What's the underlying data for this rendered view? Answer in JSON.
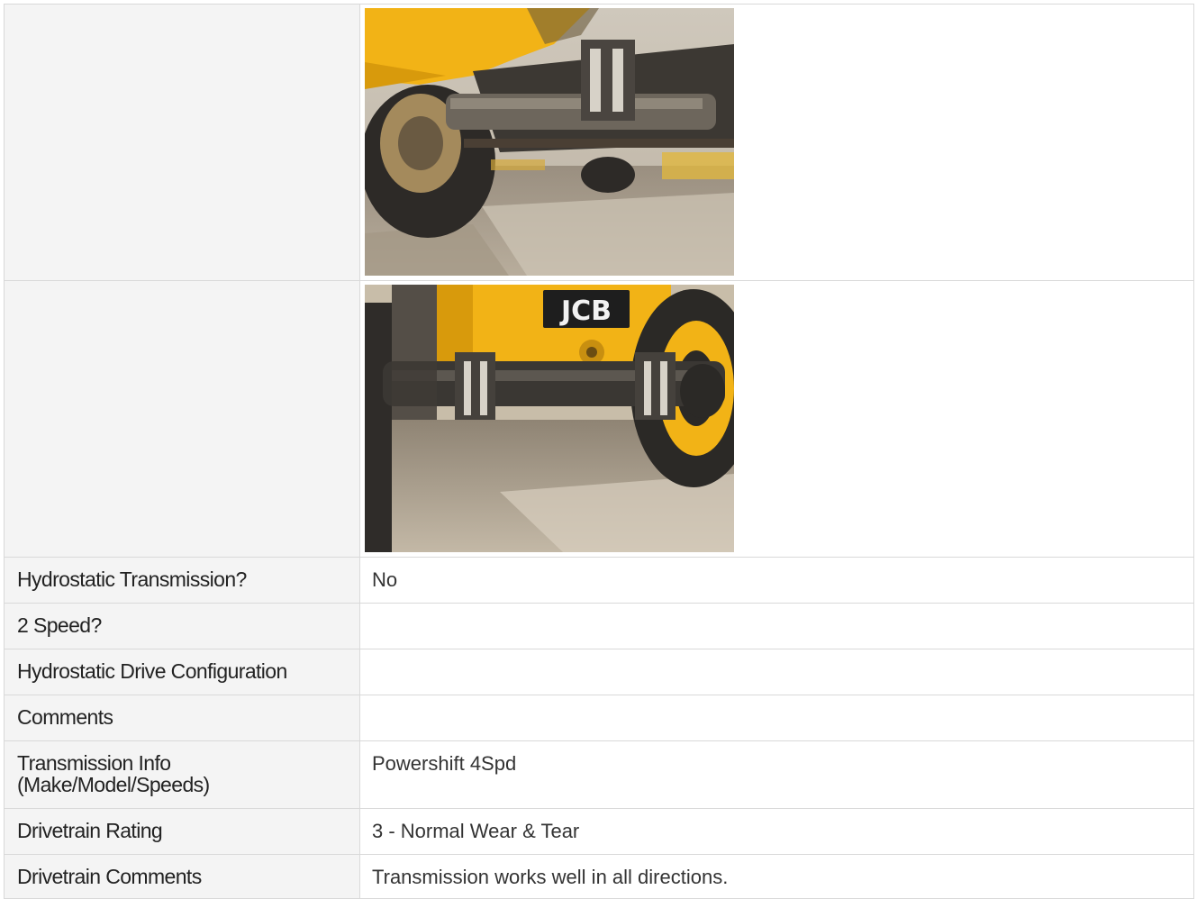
{
  "rows": [
    {
      "label": "",
      "image": "photo-axle-rear"
    },
    {
      "label": "",
      "image": "photo-axle-front-jcb"
    },
    {
      "label": "Hydrostatic Transmission?",
      "value": "No"
    },
    {
      "label": "2 Speed?",
      "value": ""
    },
    {
      "label": "Hydrostatic Drive Configuration",
      "value": ""
    },
    {
      "label": "Comments",
      "value": ""
    },
    {
      "label": "Transmission Info (Make/Model/Speeds)",
      "value": "Powershift 4Spd"
    },
    {
      "label": "Drivetrain Rating",
      "value": "3 - Normal Wear & Tear"
    },
    {
      "label": "Drivetrain Comments",
      "value": "Transmission works well in all directions."
    }
  ],
  "photo2_logo": "JCB",
  "colors": {
    "label_bg": "#f4f4f4",
    "border": "#d9d9d9",
    "machine_yellow": "#f2b316"
  }
}
